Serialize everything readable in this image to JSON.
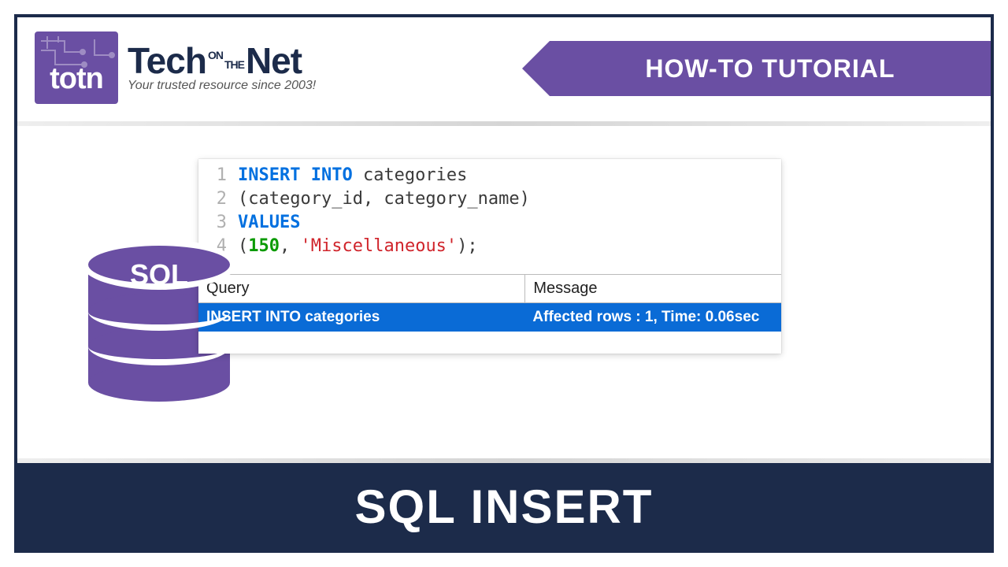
{
  "brand": {
    "logo_abbrev": "totn",
    "name_tech": "Tech",
    "name_on": "ON",
    "name_the": "THE",
    "name_net": "Net",
    "tagline": "Your trusted resource since 2003!"
  },
  "ribbon": {
    "label": "HOW-TO TUTORIAL"
  },
  "db_icon": {
    "label": "SQL"
  },
  "code": {
    "lines": [
      {
        "n": "1",
        "tokens": [
          {
            "t": "INSERT INTO",
            "c": "kw"
          },
          {
            "t": " categories",
            "c": "plain"
          }
        ]
      },
      {
        "n": "2",
        "tokens": [
          {
            "t": "(category_id, category_name)",
            "c": "plain"
          }
        ]
      },
      {
        "n": "3",
        "tokens": [
          {
            "t": "VALUES",
            "c": "kw"
          }
        ]
      },
      {
        "n": "4",
        "tokens": [
          {
            "t": "(",
            "c": "plain"
          },
          {
            "t": "150",
            "c": "num"
          },
          {
            "t": ", ",
            "c": "plain"
          },
          {
            "t": "'Miscellaneous'",
            "c": "str"
          },
          {
            "t": ");",
            "c": "plain"
          }
        ]
      }
    ]
  },
  "results": {
    "col1": "Query",
    "col2": "Message",
    "row_query": "INSERT INTO categories",
    "row_message": "Affected rows : 1, Time: 0.06sec"
  },
  "footer": {
    "title": "SQL INSERT"
  }
}
